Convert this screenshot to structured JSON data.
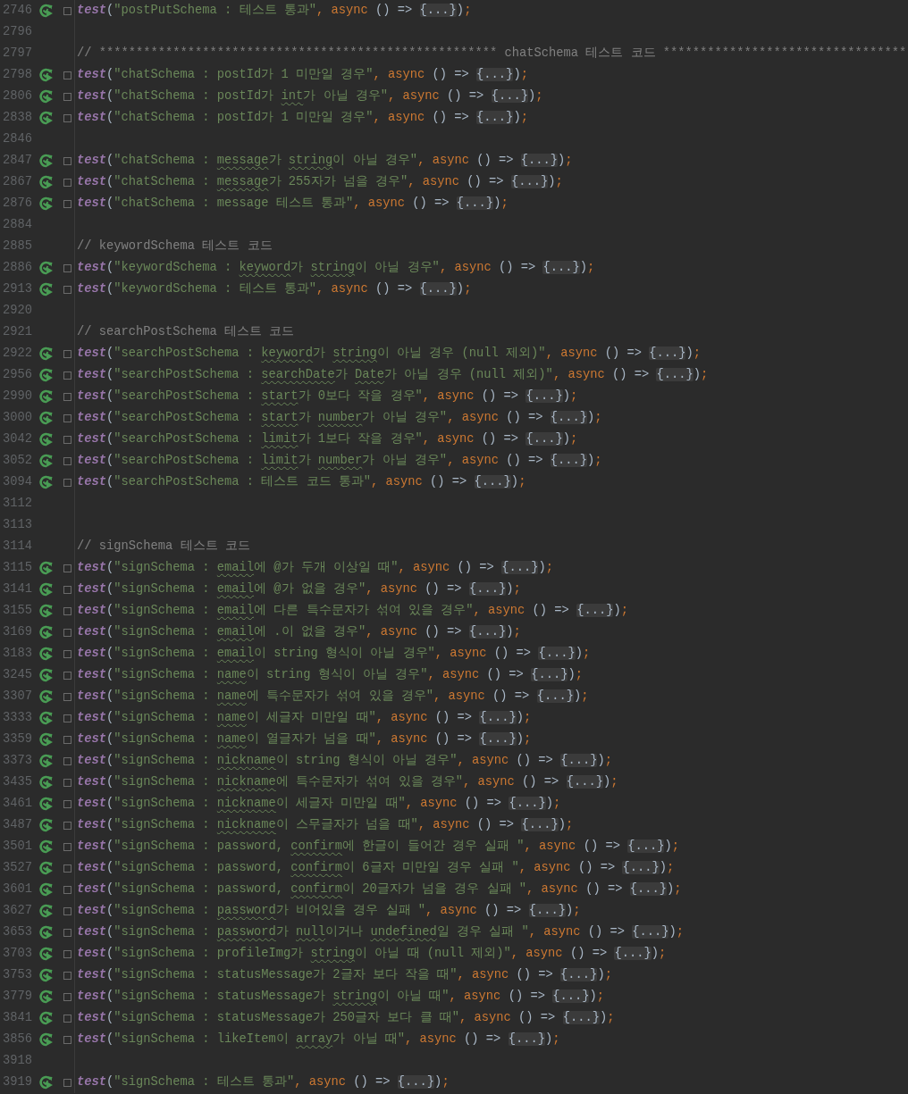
{
  "lines": [
    {
      "number": "2746",
      "kind": "test",
      "parts": [
        {
          "kind": "fn",
          "text": "test"
        },
        {
          "kind": "p",
          "text": "("
        },
        {
          "kind": "s",
          "text": "\"postPutSchema : 테스트 통과\""
        },
        {
          "kind": "k",
          "text": ", async"
        },
        {
          "kind": "p",
          "text": " () => "
        },
        {
          "kind": "f",
          "text": "{...}"
        },
        {
          "kind": "p",
          "text": ")"
        },
        {
          "kind": "k",
          "text": ";"
        }
      ]
    },
    {
      "number": "2796",
      "kind": "blank"
    },
    {
      "number": "2797",
      "kind": "comment",
      "parts": [
        {
          "kind": "c",
          "text": "// ****************************************************** chatSchema 테스트 코드 *********************************"
        }
      ]
    },
    {
      "number": "2798",
      "kind": "test",
      "parts": [
        {
          "kind": "fn",
          "text": "test"
        },
        {
          "kind": "p",
          "text": "("
        },
        {
          "kind": "s",
          "text": "\"chatSchema : postId가 1 미만일 경우\""
        },
        {
          "kind": "k",
          "text": ", async"
        },
        {
          "kind": "p",
          "text": " () => "
        },
        {
          "kind": "f",
          "text": "{...}"
        },
        {
          "kind": "p",
          "text": ")"
        },
        {
          "kind": "k",
          "text": ";"
        }
      ]
    },
    {
      "number": "2806",
      "kind": "test",
      "parts": [
        {
          "kind": "fn",
          "text": "test"
        },
        {
          "kind": "p",
          "text": "("
        },
        {
          "kind": "s",
          "text": "\"chatSchema : postId가 "
        },
        {
          "kind": "u",
          "text": "int"
        },
        {
          "kind": "s",
          "text": "가 아닐 경우\""
        },
        {
          "kind": "k",
          "text": ", async"
        },
        {
          "kind": "p",
          "text": " () => "
        },
        {
          "kind": "f",
          "text": "{...}"
        },
        {
          "kind": "p",
          "text": ")"
        },
        {
          "kind": "k",
          "text": ";"
        }
      ]
    },
    {
      "number": "2838",
      "kind": "test",
      "parts": [
        {
          "kind": "fn",
          "text": "test"
        },
        {
          "kind": "p",
          "text": "("
        },
        {
          "kind": "s",
          "text": "\"chatSchema : postId가 1 미만일 경우\""
        },
        {
          "kind": "k",
          "text": ", async"
        },
        {
          "kind": "p",
          "text": " () => "
        },
        {
          "kind": "f",
          "text": "{...}"
        },
        {
          "kind": "p",
          "text": ")"
        },
        {
          "kind": "k",
          "text": ";"
        }
      ]
    },
    {
      "number": "2846",
      "kind": "blank"
    },
    {
      "number": "2847",
      "kind": "test",
      "parts": [
        {
          "kind": "fn",
          "text": "test"
        },
        {
          "kind": "p",
          "text": "("
        },
        {
          "kind": "s",
          "text": "\"chatSchema : "
        },
        {
          "kind": "u",
          "text": "message"
        },
        {
          "kind": "s",
          "text": "가 "
        },
        {
          "kind": "u",
          "text": "string"
        },
        {
          "kind": "s",
          "text": "이 아닐 경우\""
        },
        {
          "kind": "k",
          "text": ", async"
        },
        {
          "kind": "p",
          "text": " () => "
        },
        {
          "kind": "f",
          "text": "{...}"
        },
        {
          "kind": "p",
          "text": ")"
        },
        {
          "kind": "k",
          "text": ";"
        }
      ]
    },
    {
      "number": "2867",
      "kind": "test",
      "parts": [
        {
          "kind": "fn",
          "text": "test"
        },
        {
          "kind": "p",
          "text": "("
        },
        {
          "kind": "s",
          "text": "\"chatSchema : "
        },
        {
          "kind": "u",
          "text": "message"
        },
        {
          "kind": "s",
          "text": "가 255자가 넘을 경우\""
        },
        {
          "kind": "k",
          "text": ", async"
        },
        {
          "kind": "p",
          "text": " () => "
        },
        {
          "kind": "f",
          "text": "{...}"
        },
        {
          "kind": "p",
          "text": ")"
        },
        {
          "kind": "k",
          "text": ";"
        }
      ]
    },
    {
      "number": "2876",
      "kind": "test",
      "parts": [
        {
          "kind": "fn",
          "text": "test"
        },
        {
          "kind": "p",
          "text": "("
        },
        {
          "kind": "s",
          "text": "\"chatSchema : message 테스트 통과\""
        },
        {
          "kind": "k",
          "text": ", async"
        },
        {
          "kind": "p",
          "text": " () => "
        },
        {
          "kind": "f",
          "text": "{...}"
        },
        {
          "kind": "p",
          "text": ")"
        },
        {
          "kind": "k",
          "text": ";"
        }
      ]
    },
    {
      "number": "2884",
      "kind": "blank"
    },
    {
      "number": "2885",
      "kind": "comment",
      "parts": [
        {
          "kind": "c",
          "text": "// keywordSchema 테스트 코드"
        }
      ]
    },
    {
      "number": "2886",
      "kind": "test",
      "parts": [
        {
          "kind": "fn",
          "text": "test"
        },
        {
          "kind": "p",
          "text": "("
        },
        {
          "kind": "s",
          "text": "\"keywordSchema : "
        },
        {
          "kind": "u",
          "text": "keyword"
        },
        {
          "kind": "s",
          "text": "가 "
        },
        {
          "kind": "u",
          "text": "string"
        },
        {
          "kind": "s",
          "text": "이 아닐 경우\""
        },
        {
          "kind": "k",
          "text": ", async"
        },
        {
          "kind": "p",
          "text": " () => "
        },
        {
          "kind": "f",
          "text": "{...}"
        },
        {
          "kind": "p",
          "text": ")"
        },
        {
          "kind": "k",
          "text": ";"
        }
      ]
    },
    {
      "number": "2913",
      "kind": "test",
      "parts": [
        {
          "kind": "fn",
          "text": "test"
        },
        {
          "kind": "p",
          "text": "("
        },
        {
          "kind": "s",
          "text": "\"keywordSchema : 테스트 통과\""
        },
        {
          "kind": "k",
          "text": ", async"
        },
        {
          "kind": "p",
          "text": " () => "
        },
        {
          "kind": "f",
          "text": "{...}"
        },
        {
          "kind": "p",
          "text": ")"
        },
        {
          "kind": "k",
          "text": ";"
        }
      ]
    },
    {
      "number": "2920",
      "kind": "blank"
    },
    {
      "number": "2921",
      "kind": "comment",
      "parts": [
        {
          "kind": "c",
          "text": "// searchPostSchema 테스트 코드"
        }
      ]
    },
    {
      "number": "2922",
      "kind": "test",
      "parts": [
        {
          "kind": "fn",
          "text": "test"
        },
        {
          "kind": "p",
          "text": "("
        },
        {
          "kind": "s",
          "text": "\"searchPostSchema : "
        },
        {
          "kind": "u",
          "text": "keyword"
        },
        {
          "kind": "s",
          "text": "가 "
        },
        {
          "kind": "u",
          "text": "string"
        },
        {
          "kind": "s",
          "text": "이 아닐 경우 (null 제외)\""
        },
        {
          "kind": "k",
          "text": ", async"
        },
        {
          "kind": "p",
          "text": " () => "
        },
        {
          "kind": "f",
          "text": "{...}"
        },
        {
          "kind": "p",
          "text": ")"
        },
        {
          "kind": "k",
          "text": ";"
        }
      ]
    },
    {
      "number": "2956",
      "kind": "test",
      "parts": [
        {
          "kind": "fn",
          "text": "test"
        },
        {
          "kind": "p",
          "text": "("
        },
        {
          "kind": "s",
          "text": "\"searchPostSchema : "
        },
        {
          "kind": "u",
          "text": "searchDate"
        },
        {
          "kind": "s",
          "text": "가 "
        },
        {
          "kind": "u",
          "text": "Date"
        },
        {
          "kind": "s",
          "text": "가 아닐 경우 (null 제외)\""
        },
        {
          "kind": "k",
          "text": ", async"
        },
        {
          "kind": "p",
          "text": " () => "
        },
        {
          "kind": "f",
          "text": "{...}"
        },
        {
          "kind": "p",
          "text": ")"
        },
        {
          "kind": "k",
          "text": ";"
        }
      ]
    },
    {
      "number": "2990",
      "kind": "test",
      "parts": [
        {
          "kind": "fn",
          "text": "test"
        },
        {
          "kind": "p",
          "text": "("
        },
        {
          "kind": "s",
          "text": "\"searchPostSchema : "
        },
        {
          "kind": "u",
          "text": "start"
        },
        {
          "kind": "s",
          "text": "가 0보다 작을 경우\""
        },
        {
          "kind": "k",
          "text": ", async"
        },
        {
          "kind": "p",
          "text": " () => "
        },
        {
          "kind": "f",
          "text": "{...}"
        },
        {
          "kind": "p",
          "text": ")"
        },
        {
          "kind": "k",
          "text": ";"
        }
      ]
    },
    {
      "number": "3000",
      "kind": "test",
      "parts": [
        {
          "kind": "fn",
          "text": "test"
        },
        {
          "kind": "p",
          "text": "("
        },
        {
          "kind": "s",
          "text": "\"searchPostSchema : "
        },
        {
          "kind": "u",
          "text": "start"
        },
        {
          "kind": "s",
          "text": "가 "
        },
        {
          "kind": "u",
          "text": "number"
        },
        {
          "kind": "s",
          "text": "가 아닐 경우\""
        },
        {
          "kind": "k",
          "text": ", async"
        },
        {
          "kind": "p",
          "text": " () => "
        },
        {
          "kind": "f",
          "text": "{...}"
        },
        {
          "kind": "p",
          "text": ")"
        },
        {
          "kind": "k",
          "text": ";"
        }
      ]
    },
    {
      "number": "3042",
      "kind": "test",
      "parts": [
        {
          "kind": "fn",
          "text": "test"
        },
        {
          "kind": "p",
          "text": "("
        },
        {
          "kind": "s",
          "text": "\"searchPostSchema : "
        },
        {
          "kind": "u",
          "text": "limit"
        },
        {
          "kind": "s",
          "text": "가 1보다 작을 경우\""
        },
        {
          "kind": "k",
          "text": ", async"
        },
        {
          "kind": "p",
          "text": " () => "
        },
        {
          "kind": "f",
          "text": "{...}"
        },
        {
          "kind": "p",
          "text": ")"
        },
        {
          "kind": "k",
          "text": ";"
        }
      ]
    },
    {
      "number": "3052",
      "kind": "test",
      "parts": [
        {
          "kind": "fn",
          "text": "test"
        },
        {
          "kind": "p",
          "text": "("
        },
        {
          "kind": "s",
          "text": "\"searchPostSchema : "
        },
        {
          "kind": "u",
          "text": "limit"
        },
        {
          "kind": "s",
          "text": "가 "
        },
        {
          "kind": "u",
          "text": "number"
        },
        {
          "kind": "s",
          "text": "가 아닐 경우\""
        },
        {
          "kind": "k",
          "text": ", async"
        },
        {
          "kind": "p",
          "text": " () => "
        },
        {
          "kind": "f",
          "text": "{...}"
        },
        {
          "kind": "p",
          "text": ")"
        },
        {
          "kind": "k",
          "text": ";"
        }
      ]
    },
    {
      "number": "3094",
      "kind": "test",
      "parts": [
        {
          "kind": "fn",
          "text": "test"
        },
        {
          "kind": "p",
          "text": "("
        },
        {
          "kind": "s",
          "text": "\"searchPostSchema : 테스트 코드 통과\""
        },
        {
          "kind": "k",
          "text": ", async"
        },
        {
          "kind": "p",
          "text": " () => "
        },
        {
          "kind": "f",
          "text": "{...}"
        },
        {
          "kind": "p",
          "text": ")"
        },
        {
          "kind": "k",
          "text": ";"
        }
      ]
    },
    {
      "number": "3112",
      "kind": "blank"
    },
    {
      "number": "3113",
      "kind": "blank"
    },
    {
      "number": "3114",
      "kind": "comment",
      "parts": [
        {
          "kind": "c",
          "text": "// signSchema 테스트 코드"
        }
      ]
    },
    {
      "number": "3115",
      "kind": "test",
      "parts": [
        {
          "kind": "fn",
          "text": "test"
        },
        {
          "kind": "p",
          "text": "("
        },
        {
          "kind": "s",
          "text": "\"signSchema : "
        },
        {
          "kind": "u",
          "text": "email"
        },
        {
          "kind": "s",
          "text": "에 @가 두개 이상일 때\""
        },
        {
          "kind": "k",
          "text": ", async"
        },
        {
          "kind": "p",
          "text": " () => "
        },
        {
          "kind": "f",
          "text": "{...}"
        },
        {
          "kind": "p",
          "text": ")"
        },
        {
          "kind": "k",
          "text": ";"
        }
      ]
    },
    {
      "number": "3141",
      "kind": "test",
      "parts": [
        {
          "kind": "fn",
          "text": "test"
        },
        {
          "kind": "p",
          "text": "("
        },
        {
          "kind": "s",
          "text": "\"signSchema : "
        },
        {
          "kind": "u",
          "text": "email"
        },
        {
          "kind": "s",
          "text": "에 @가 없을 경우\""
        },
        {
          "kind": "k",
          "text": ", async"
        },
        {
          "kind": "p",
          "text": " () => "
        },
        {
          "kind": "f",
          "text": "{...}"
        },
        {
          "kind": "p",
          "text": ")"
        },
        {
          "kind": "k",
          "text": ";"
        }
      ]
    },
    {
      "number": "3155",
      "kind": "test",
      "parts": [
        {
          "kind": "fn",
          "text": "test"
        },
        {
          "kind": "p",
          "text": "("
        },
        {
          "kind": "s",
          "text": "\"signSchema : "
        },
        {
          "kind": "u",
          "text": "email"
        },
        {
          "kind": "s",
          "text": "에 다른 특수문자가 섞여 있을 경우\""
        },
        {
          "kind": "k",
          "text": ", async"
        },
        {
          "kind": "p",
          "text": " () => "
        },
        {
          "kind": "f",
          "text": "{...}"
        },
        {
          "kind": "p",
          "text": ")"
        },
        {
          "kind": "k",
          "text": ";"
        }
      ]
    },
    {
      "number": "3169",
      "kind": "test",
      "parts": [
        {
          "kind": "fn",
          "text": "test"
        },
        {
          "kind": "p",
          "text": "("
        },
        {
          "kind": "s",
          "text": "\"signSchema : "
        },
        {
          "kind": "u",
          "text": "email"
        },
        {
          "kind": "s",
          "text": "에 .이 없을 경우\""
        },
        {
          "kind": "k",
          "text": ", async"
        },
        {
          "kind": "p",
          "text": " () => "
        },
        {
          "kind": "f",
          "text": "{...}"
        },
        {
          "kind": "p",
          "text": ")"
        },
        {
          "kind": "k",
          "text": ";"
        }
      ]
    },
    {
      "number": "3183",
      "kind": "test",
      "parts": [
        {
          "kind": "fn",
          "text": "test"
        },
        {
          "kind": "p",
          "text": "("
        },
        {
          "kind": "s",
          "text": "\"signSchema : "
        },
        {
          "kind": "u",
          "text": "email"
        },
        {
          "kind": "s",
          "text": "이 string 형식이 아닐 경우\""
        },
        {
          "kind": "k",
          "text": ", async"
        },
        {
          "kind": "p",
          "text": " () => "
        },
        {
          "kind": "f",
          "text": "{...}"
        },
        {
          "kind": "p",
          "text": ")"
        },
        {
          "kind": "k",
          "text": ";"
        }
      ]
    },
    {
      "number": "3245",
      "kind": "test",
      "parts": [
        {
          "kind": "fn",
          "text": "test"
        },
        {
          "kind": "p",
          "text": "("
        },
        {
          "kind": "s",
          "text": "\"signSchema : "
        },
        {
          "kind": "u",
          "text": "name"
        },
        {
          "kind": "s",
          "text": "이 string 형식이 아닐 경우\""
        },
        {
          "kind": "k",
          "text": ", async"
        },
        {
          "kind": "p",
          "text": " () => "
        },
        {
          "kind": "f",
          "text": "{...}"
        },
        {
          "kind": "p",
          "text": ")"
        },
        {
          "kind": "k",
          "text": ";"
        }
      ]
    },
    {
      "number": "3307",
      "kind": "test",
      "parts": [
        {
          "kind": "fn",
          "text": "test"
        },
        {
          "kind": "p",
          "text": "("
        },
        {
          "kind": "s",
          "text": "\"signSchema : "
        },
        {
          "kind": "u",
          "text": "name"
        },
        {
          "kind": "s",
          "text": "에 특수문자가 섞여 있을 경우\""
        },
        {
          "kind": "k",
          "text": ", async"
        },
        {
          "kind": "p",
          "text": " () => "
        },
        {
          "kind": "f",
          "text": "{...}"
        },
        {
          "kind": "p",
          "text": ")"
        },
        {
          "kind": "k",
          "text": ";"
        }
      ]
    },
    {
      "number": "3333",
      "kind": "test",
      "parts": [
        {
          "kind": "fn",
          "text": "test"
        },
        {
          "kind": "p",
          "text": "("
        },
        {
          "kind": "s",
          "text": "\"signSchema : "
        },
        {
          "kind": "u",
          "text": "name"
        },
        {
          "kind": "s",
          "text": "이 세글자 미만일 때\""
        },
        {
          "kind": "k",
          "text": ", async"
        },
        {
          "kind": "p",
          "text": " () => "
        },
        {
          "kind": "f",
          "text": "{...}"
        },
        {
          "kind": "p",
          "text": ")"
        },
        {
          "kind": "k",
          "text": ";"
        }
      ]
    },
    {
      "number": "3359",
      "kind": "test",
      "parts": [
        {
          "kind": "fn",
          "text": "test"
        },
        {
          "kind": "p",
          "text": "("
        },
        {
          "kind": "s",
          "text": "\"signSchema : "
        },
        {
          "kind": "u",
          "text": "name"
        },
        {
          "kind": "s",
          "text": "이 열글자가 넘을 때\""
        },
        {
          "kind": "k",
          "text": ", async"
        },
        {
          "kind": "p",
          "text": " () => "
        },
        {
          "kind": "f",
          "text": "{...}"
        },
        {
          "kind": "p",
          "text": ")"
        },
        {
          "kind": "k",
          "text": ";"
        }
      ]
    },
    {
      "number": "3373",
      "kind": "test",
      "parts": [
        {
          "kind": "fn",
          "text": "test"
        },
        {
          "kind": "p",
          "text": "("
        },
        {
          "kind": "s",
          "text": "\"signSchema : "
        },
        {
          "kind": "u",
          "text": "nickname"
        },
        {
          "kind": "s",
          "text": "이 string 형식이 아닐 경우\""
        },
        {
          "kind": "k",
          "text": ", async"
        },
        {
          "kind": "p",
          "text": " () => "
        },
        {
          "kind": "f",
          "text": "{...}"
        },
        {
          "kind": "p",
          "text": ")"
        },
        {
          "kind": "k",
          "text": ";"
        }
      ]
    },
    {
      "number": "3435",
      "kind": "test",
      "parts": [
        {
          "kind": "fn",
          "text": "test"
        },
        {
          "kind": "p",
          "text": "("
        },
        {
          "kind": "s",
          "text": "\"signSchema : "
        },
        {
          "kind": "u",
          "text": "nickname"
        },
        {
          "kind": "s",
          "text": "에 특수문자가 섞여 있을 경우\""
        },
        {
          "kind": "k",
          "text": ", async"
        },
        {
          "kind": "p",
          "text": " () => "
        },
        {
          "kind": "f",
          "text": "{...}"
        },
        {
          "kind": "p",
          "text": ")"
        },
        {
          "kind": "k",
          "text": ";"
        }
      ]
    },
    {
      "number": "3461",
      "kind": "test",
      "parts": [
        {
          "kind": "fn",
          "text": "test"
        },
        {
          "kind": "p",
          "text": "("
        },
        {
          "kind": "s",
          "text": "\"signSchema : "
        },
        {
          "kind": "u",
          "text": "nickname"
        },
        {
          "kind": "s",
          "text": "이 세글자 미만일 때\""
        },
        {
          "kind": "k",
          "text": ", async"
        },
        {
          "kind": "p",
          "text": " () => "
        },
        {
          "kind": "f",
          "text": "{...}"
        },
        {
          "kind": "p",
          "text": ")"
        },
        {
          "kind": "k",
          "text": ";"
        }
      ]
    },
    {
      "number": "3487",
      "kind": "test",
      "parts": [
        {
          "kind": "fn",
          "text": "test"
        },
        {
          "kind": "p",
          "text": "("
        },
        {
          "kind": "s",
          "text": "\"signSchema : "
        },
        {
          "kind": "u",
          "text": "nickname"
        },
        {
          "kind": "s",
          "text": "이 스무글자가 넘을 때\""
        },
        {
          "kind": "k",
          "text": ", async"
        },
        {
          "kind": "p",
          "text": " () => "
        },
        {
          "kind": "f",
          "text": "{...}"
        },
        {
          "kind": "p",
          "text": ")"
        },
        {
          "kind": "k",
          "text": ";"
        }
      ]
    },
    {
      "number": "3501",
      "kind": "test",
      "parts": [
        {
          "kind": "fn",
          "text": "test"
        },
        {
          "kind": "p",
          "text": "("
        },
        {
          "kind": "s",
          "text": "\"signSchema : password, "
        },
        {
          "kind": "u",
          "text": "confirm"
        },
        {
          "kind": "s",
          "text": "에 한글이 들어간 경우 실패 \""
        },
        {
          "kind": "k",
          "text": ", async"
        },
        {
          "kind": "p",
          "text": " () => "
        },
        {
          "kind": "f",
          "text": "{...}"
        },
        {
          "kind": "p",
          "text": ")"
        },
        {
          "kind": "k",
          "text": ";"
        }
      ]
    },
    {
      "number": "3527",
      "kind": "test",
      "parts": [
        {
          "kind": "fn",
          "text": "test"
        },
        {
          "kind": "p",
          "text": "("
        },
        {
          "kind": "s",
          "text": "\"signSchema : password, "
        },
        {
          "kind": "u",
          "text": "confirm"
        },
        {
          "kind": "s",
          "text": "이 6글자 미만일 경우 실패 \""
        },
        {
          "kind": "k",
          "text": ", async"
        },
        {
          "kind": "p",
          "text": " () => "
        },
        {
          "kind": "f",
          "text": "{...}"
        },
        {
          "kind": "p",
          "text": ")"
        },
        {
          "kind": "k",
          "text": ";"
        }
      ]
    },
    {
      "number": "3601",
      "kind": "test",
      "parts": [
        {
          "kind": "fn",
          "text": "test"
        },
        {
          "kind": "p",
          "text": "("
        },
        {
          "kind": "s",
          "text": "\"signSchema : password, "
        },
        {
          "kind": "u",
          "text": "confirm"
        },
        {
          "kind": "s",
          "text": "이 20글자가 넘을 경우 실패 \""
        },
        {
          "kind": "k",
          "text": ", async"
        },
        {
          "kind": "p",
          "text": " () => "
        },
        {
          "kind": "f",
          "text": "{...}"
        },
        {
          "kind": "p",
          "text": ")"
        },
        {
          "kind": "k",
          "text": ";"
        }
      ]
    },
    {
      "number": "3627",
      "kind": "test",
      "parts": [
        {
          "kind": "fn",
          "text": "test"
        },
        {
          "kind": "p",
          "text": "("
        },
        {
          "kind": "s",
          "text": "\"signSchema : "
        },
        {
          "kind": "u",
          "text": "password"
        },
        {
          "kind": "s",
          "text": "가 비어있을 경우 실패 \""
        },
        {
          "kind": "k",
          "text": ", async"
        },
        {
          "kind": "p",
          "text": " () => "
        },
        {
          "kind": "f",
          "text": "{...}"
        },
        {
          "kind": "p",
          "text": ")"
        },
        {
          "kind": "k",
          "text": ";"
        }
      ]
    },
    {
      "number": "3653",
      "kind": "test",
      "parts": [
        {
          "kind": "fn",
          "text": "test"
        },
        {
          "kind": "p",
          "text": "("
        },
        {
          "kind": "s",
          "text": "\"signSchema : "
        },
        {
          "kind": "u",
          "text": "password"
        },
        {
          "kind": "s",
          "text": "가 "
        },
        {
          "kind": "u",
          "text": "null"
        },
        {
          "kind": "s",
          "text": "이거나 "
        },
        {
          "kind": "u",
          "text": "undefined"
        },
        {
          "kind": "s",
          "text": "일 경우 실패 \""
        },
        {
          "kind": "k",
          "text": ", async"
        },
        {
          "kind": "p",
          "text": " () => "
        },
        {
          "kind": "f",
          "text": "{...}"
        },
        {
          "kind": "p",
          "text": ")"
        },
        {
          "kind": "k",
          "text": ";"
        }
      ]
    },
    {
      "number": "3703",
      "kind": "test",
      "parts": [
        {
          "kind": "fn",
          "text": "test"
        },
        {
          "kind": "p",
          "text": "("
        },
        {
          "kind": "s",
          "text": "\"signSchema : profileImg가 "
        },
        {
          "kind": "u",
          "text": "string"
        },
        {
          "kind": "s",
          "text": "이 아닐 때 (null 제외)\""
        },
        {
          "kind": "k",
          "text": ", async"
        },
        {
          "kind": "p",
          "text": " () => "
        },
        {
          "kind": "f",
          "text": "{...}"
        },
        {
          "kind": "p",
          "text": ")"
        },
        {
          "kind": "k",
          "text": ";"
        }
      ]
    },
    {
      "number": "3753",
      "kind": "test",
      "parts": [
        {
          "kind": "fn",
          "text": "test"
        },
        {
          "kind": "p",
          "text": "("
        },
        {
          "kind": "s",
          "text": "\"signSchema : statusMessage가 2글자 보다 작을 때\""
        },
        {
          "kind": "k",
          "text": ", async"
        },
        {
          "kind": "p",
          "text": " () => "
        },
        {
          "kind": "f",
          "text": "{...}"
        },
        {
          "kind": "p",
          "text": ")"
        },
        {
          "kind": "k",
          "text": ";"
        }
      ]
    },
    {
      "number": "3779",
      "kind": "test",
      "parts": [
        {
          "kind": "fn",
          "text": "test"
        },
        {
          "kind": "p",
          "text": "("
        },
        {
          "kind": "s",
          "text": "\"signSchema : statusMessage가 "
        },
        {
          "kind": "u",
          "text": "string"
        },
        {
          "kind": "s",
          "text": "이 아닐 때\""
        },
        {
          "kind": "k",
          "text": ", async"
        },
        {
          "kind": "p",
          "text": " () => "
        },
        {
          "kind": "f",
          "text": "{...}"
        },
        {
          "kind": "p",
          "text": ")"
        },
        {
          "kind": "k",
          "text": ";"
        }
      ]
    },
    {
      "number": "3841",
      "kind": "test",
      "parts": [
        {
          "kind": "fn",
          "text": "test"
        },
        {
          "kind": "p",
          "text": "("
        },
        {
          "kind": "s",
          "text": "\"signSchema : statusMessage가 250글자 보다 클 때\""
        },
        {
          "kind": "k",
          "text": ", async"
        },
        {
          "kind": "p",
          "text": " () => "
        },
        {
          "kind": "f",
          "text": "{...}"
        },
        {
          "kind": "p",
          "text": ")"
        },
        {
          "kind": "k",
          "text": ";"
        }
      ]
    },
    {
      "number": "3856",
      "kind": "test",
      "parts": [
        {
          "kind": "fn",
          "text": "test"
        },
        {
          "kind": "p",
          "text": "("
        },
        {
          "kind": "s",
          "text": "\"signSchema : likeItem이 "
        },
        {
          "kind": "u",
          "text": "array"
        },
        {
          "kind": "s",
          "text": "가 아닐 때\""
        },
        {
          "kind": "k",
          "text": ", async"
        },
        {
          "kind": "p",
          "text": " () => "
        },
        {
          "kind": "f",
          "text": "{...}"
        },
        {
          "kind": "p",
          "text": ")"
        },
        {
          "kind": "k",
          "text": ";"
        }
      ]
    },
    {
      "number": "3918",
      "kind": "blank"
    },
    {
      "number": "3919",
      "kind": "test",
      "parts": [
        {
          "kind": "fn",
          "text": "test"
        },
        {
          "kind": "p",
          "text": "("
        },
        {
          "kind": "s",
          "text": "\"signSchema : 테스트 통과\""
        },
        {
          "kind": "k",
          "text": ", async"
        },
        {
          "kind": "p",
          "text": " () => "
        },
        {
          "kind": "f",
          "text": "{...}"
        },
        {
          "kind": "p",
          "text": ")"
        },
        {
          "kind": "k",
          "text": ";"
        }
      ]
    }
  ]
}
